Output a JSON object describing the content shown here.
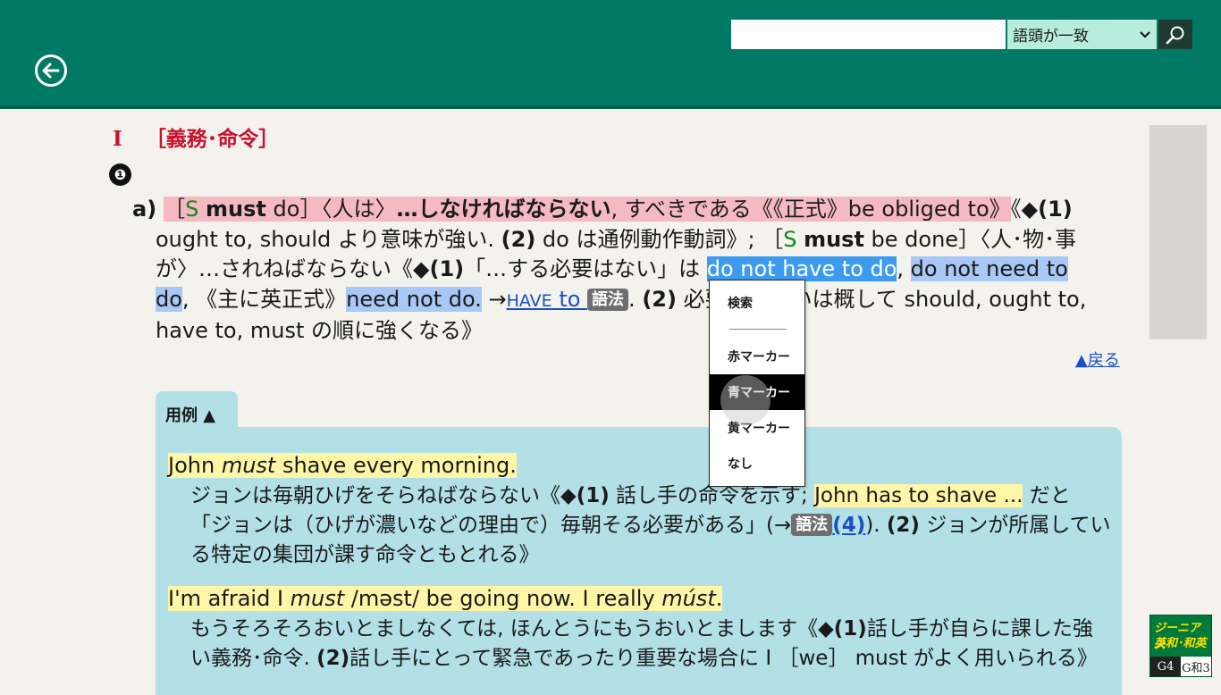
{
  "search": {
    "value": "",
    "match_mode": "語頭が一致"
  },
  "colors": {
    "header": "#007a64",
    "highlight_pink": "#f5b9c2",
    "highlight_blue": "#3c9bf0",
    "highlight_blue_light": "#a9c8f5",
    "example_bg": "#b2e0e6",
    "example_highlight": "#fff6a8"
  },
  "section": {
    "number": "I",
    "title": "［義務･命令］",
    "circle": "❶"
  },
  "definition": {
    "label": "a)",
    "part1": "［",
    "S1": "S",
    "must1": "must",
    "part2": " do］〈人は〉",
    "bold_meaning": "…しなければならない",
    "part3": ", すべきである《《正式》be obliged to》",
    "part4": "《◆",
    "n1": "(1)",
    "part5": " ought to, should より意味が強い. ",
    "n2": "(2)",
    "part6": " do は通例動作動詞》; ［",
    "S2": "S",
    "must2": "must",
    "part7": " be done］〈人･物･事が〉…されねばならない《◆",
    "n3": "(1)",
    "part8": "「…する必要はない」は ",
    "hl1": "do not have to do",
    "part9": ", ",
    "hl2": "do not need to do",
    "part10": ", 《主に英正式》",
    "hl3": "need not do.",
    "part11": " →",
    "link_have": "HAVE",
    "link_to": " to ",
    "badge": "語法",
    "part12": ". ",
    "n4": "(2)",
    "part13": " 必要の度合いは概して should, ought to, have to, must の順に強くなる》"
  },
  "back_link": "▲戻る",
  "examples": {
    "tab_label": "用例 ▲",
    "ex1": {
      "pre": "John ",
      "em": "must",
      "post": " shave every morning.",
      "t_a": "ジョンは毎朝ひげをそらねばならない《◆",
      "t_n1": "(1)",
      "t_b": " 話し手の命令を示す; ",
      "t_hl": "John has to shave ...",
      "t_c": " だと「ジョンは（ひげが濃いなどの理由で）毎朝そる必要がある」(→",
      "t_badge": "語法",
      "t_link": "(4)",
      "t_d": "). ",
      "t_n2": "(2)",
      "t_e": " ジョンが所属している特定の集団が課す命令ともとれる》"
    },
    "ex2": {
      "pre": "I'm afraid I ",
      "em1": "must",
      "mid": " /məst/ be going now. I really ",
      "em2": "múst",
      "post": ".",
      "t_a": "もうそろそろおいとましなくては, ほんとうにもうおいとまします《◆",
      "t_n1": "(1)",
      "t_b": "話し手が自らに課した強い義務･命令. ",
      "t_n2": "(2)",
      "t_c": "話し手にとって緊急であったり重要な場合に I ［we］ must がよく用いられる》"
    }
  },
  "context_menu": {
    "items": [
      "検索",
      "赤マーカー",
      "青マーカー",
      "黄マーカー",
      "なし"
    ],
    "active": "青マーカー"
  },
  "logo": {
    "line1": "ジーニアス",
    "line2": "英和･和英",
    "g4": "G4",
    "g3": "G和3"
  }
}
